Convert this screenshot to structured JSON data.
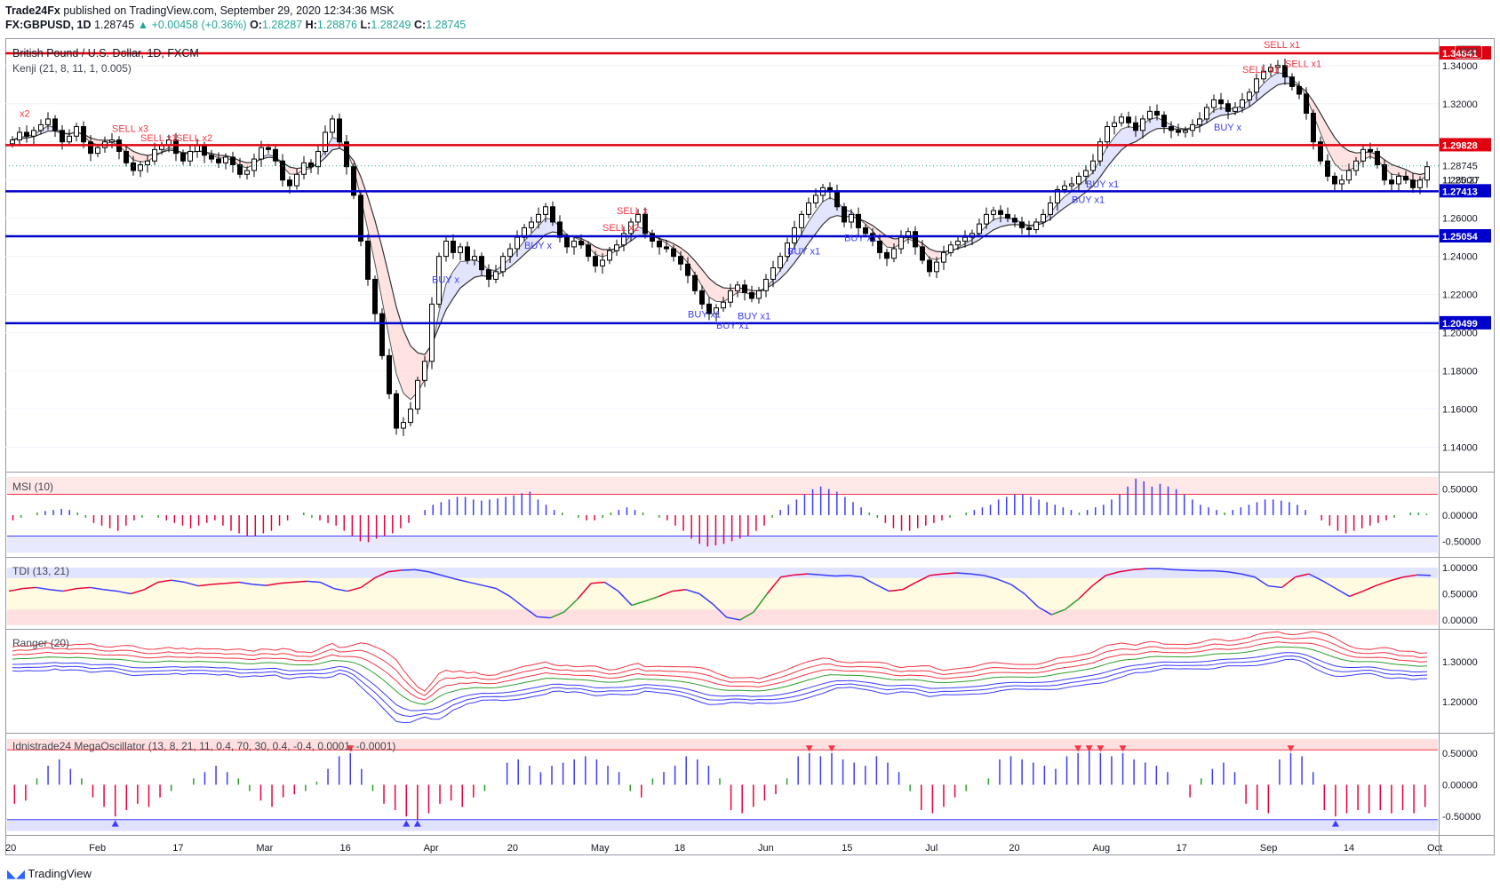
{
  "header": {
    "publisher": "Trade24Fx",
    "published_text": "published on TradingView.com, September 29, 2020 12:34:36 MSK",
    "symbol": "FX:GBPUSD, 1D",
    "last": "1.28745",
    "change": "+0.00458 (+0.36%)",
    "open_label": "O:",
    "open": "1.28287",
    "high_label": "H:",
    "high": "1.28876",
    "low_label": "L:",
    "low": "1.28249",
    "close_label": "C:",
    "close": "1.28745"
  },
  "currency_badge": "USD",
  "countdown": "11:25:27",
  "footer_brand": "TradingView",
  "colors": {
    "red_line": "#e0000f",
    "blue_line": "#0000cc",
    "bull": "#ffffff",
    "bear": "#000000",
    "indicator_blue": "#3b3bff",
    "indicator_red": "#e8003b",
    "indicator_green": "#2e9d2e"
  },
  "x_axis": [
    "20",
    "Feb",
    "17",
    "Mar",
    "16",
    "Apr",
    "20",
    "May",
    "18",
    "Jun",
    "15",
    "Jul",
    "20",
    "Aug",
    "17",
    "Sep",
    "14",
    "Oct"
  ],
  "chart_data": [
    {
      "type": "candlestick",
      "title": "British Pound / U.S. Dollar, 1D, FXCM",
      "indicator_label": "Kenji (21, 8, 11, 1, 0.005)",
      "y_ticks": [
        "1.34000",
        "1.32000",
        "1.30000",
        "1.28000",
        "1.26000",
        "1.24000",
        "1.22000",
        "1.20000",
        "1.18000",
        "1.16000",
        "1.14000"
      ],
      "ylim": [
        1.13,
        1.352
      ],
      "horizontal_levels": [
        {
          "value": "1.34641",
          "color": "red"
        },
        {
          "value": "1.29828",
          "color": "red"
        },
        {
          "value": "1.27413",
          "color": "blue"
        },
        {
          "value": "1.25054",
          "color": "blue"
        },
        {
          "value": "1.20499",
          "color": "blue"
        }
      ],
      "last_price": "1.28745",
      "close_path": [
        1.301,
        1.305,
        1.303,
        1.306,
        1.309,
        1.312,
        1.306,
        1.3,
        1.303,
        1.308,
        1.3,
        1.294,
        1.297,
        1.3,
        1.301,
        1.295,
        1.289,
        1.285,
        1.288,
        1.29,
        1.296,
        1.298,
        1.301,
        1.294,
        1.29,
        1.295,
        1.298,
        1.293,
        1.291,
        1.289,
        1.292,
        1.288,
        1.283,
        1.285,
        1.291,
        1.297,
        1.296,
        1.29,
        1.28,
        1.277,
        1.283,
        1.289,
        1.287,
        1.295,
        1.305,
        1.312,
        1.3,
        1.287,
        1.272,
        1.248,
        1.228,
        1.21,
        1.188,
        1.168,
        1.15,
        1.153,
        1.16,
        1.175,
        1.185,
        1.215,
        1.24,
        1.248,
        1.242,
        1.245,
        1.238,
        1.24,
        1.233,
        1.228,
        1.232,
        1.24,
        1.244,
        1.25,
        1.255,
        1.258,
        1.262,
        1.266,
        1.258,
        1.25,
        1.245,
        1.248,
        1.246,
        1.24,
        1.235,
        1.238,
        1.243,
        1.246,
        1.252,
        1.258,
        1.262,
        1.252,
        1.248,
        1.245,
        1.244,
        1.24,
        1.236,
        1.23,
        1.222,
        1.215,
        1.21,
        1.213,
        1.216,
        1.222,
        1.225,
        1.221,
        1.218,
        1.222,
        1.228,
        1.234,
        1.24,
        1.247,
        1.255,
        1.262,
        1.268,
        1.272,
        1.276,
        1.274,
        1.266,
        1.258,
        1.262,
        1.255,
        1.252,
        1.248,
        1.242,
        1.239,
        1.244,
        1.25,
        1.253,
        1.245,
        1.238,
        1.232,
        1.237,
        1.242,
        1.246,
        1.248,
        1.25,
        1.252,
        1.257,
        1.262,
        1.264,
        1.262,
        1.26,
        1.258,
        1.255,
        1.254,
        1.258,
        1.262,
        1.268,
        1.275,
        1.277,
        1.278,
        1.282,
        1.285,
        1.29,
        1.3,
        1.308,
        1.31,
        1.313,
        1.31,
        1.306,
        1.312,
        1.316,
        1.314,
        1.308,
        1.306,
        1.305,
        1.306,
        1.309,
        1.312,
        1.318,
        1.322,
        1.32,
        1.316,
        1.318,
        1.322,
        1.326,
        1.333,
        1.337,
        1.339,
        1.34,
        1.334,
        1.329,
        1.325,
        1.315,
        1.3,
        1.29,
        1.282,
        1.278,
        1.28,
        1.285,
        1.29,
        1.296,
        1.295,
        1.288,
        1.28,
        1.278,
        1.282,
        1.28,
        1.276,
        1.28,
        1.287
      ],
      "signals": [
        {
          "text": "x2",
          "type": "sell"
        },
        {
          "text": "SELL x3",
          "type": "sell"
        },
        {
          "text": "SELL x1",
          "type": "sell"
        },
        {
          "text": "SELL x2",
          "type": "sell"
        },
        {
          "text": "BUY x",
          "type": "buy"
        },
        {
          "text": "BUY x",
          "type": "buy"
        },
        {
          "text": "SELL x2",
          "type": "sell"
        },
        {
          "text": "SELL x",
          "type": "sell"
        },
        {
          "text": "BUY x1",
          "type": "buy"
        },
        {
          "text": "BUY x1",
          "type": "buy"
        },
        {
          "text": "BUY x1",
          "type": "buy"
        },
        {
          "text": "BUY x1",
          "type": "buy"
        },
        {
          "text": "BUY x1",
          "type": "buy"
        },
        {
          "text": "BUY x1",
          "type": "buy"
        },
        {
          "text": "BUY x1",
          "type": "buy"
        },
        {
          "text": "BUY x",
          "type": "buy"
        },
        {
          "text": "SELL x1",
          "type": "sell"
        },
        {
          "text": "SELL x1",
          "type": "sell"
        },
        {
          "text": "SELL x1",
          "type": "sell"
        }
      ]
    },
    {
      "type": "histogram",
      "title": "MSI (10)",
      "y_ticks": [
        "0.50000",
        "0.00000",
        "-0.50000"
      ],
      "ylim": [
        -0.75,
        0.75
      ],
      "band": [
        -0.4,
        0.4
      ],
      "values": [
        -0.1,
        -0.05,
        0.0,
        0.05,
        0.08,
        0.1,
        0.12,
        0.1,
        0.05,
        -0.05,
        -0.15,
        -0.2,
        -0.25,
        -0.3,
        -0.2,
        -0.1,
        -0.05,
        0.0,
        -0.05,
        -0.1,
        -0.15,
        -0.2,
        -0.25,
        -0.2,
        -0.15,
        -0.1,
        -0.2,
        -0.3,
        -0.35,
        -0.4,
        -0.4,
        -0.35,
        -0.3,
        -0.2,
        -0.1,
        0.0,
        0.05,
        -0.05,
        -0.1,
        -0.15,
        -0.2,
        -0.3,
        -0.4,
        -0.5,
        -0.52,
        -0.45,
        -0.4,
        -0.35,
        -0.25,
        -0.15,
        0.0,
        0.1,
        0.2,
        0.25,
        0.3,
        0.35,
        0.35,
        0.3,
        0.28,
        0.3,
        0.32,
        0.35,
        0.38,
        0.42,
        0.45,
        0.3,
        0.2,
        0.1,
        0.05,
        0.0,
        -0.05,
        -0.1,
        -0.1,
        -0.05,
        0.05,
        0.1,
        0.15,
        0.1,
        0.05,
        0.0,
        -0.05,
        -0.1,
        -0.2,
        -0.3,
        -0.45,
        -0.55,
        -0.6,
        -0.58,
        -0.55,
        -0.5,
        -0.45,
        -0.4,
        -0.3,
        -0.2,
        -0.05,
        0.1,
        0.2,
        0.3,
        0.4,
        0.5,
        0.55,
        0.5,
        0.45,
        0.35,
        0.25,
        0.15,
        0.05,
        -0.05,
        -0.15,
        -0.25,
        -0.3,
        -0.3,
        -0.25,
        -0.2,
        -0.15,
        -0.1,
        -0.05,
        0.0,
        0.05,
        0.1,
        0.15,
        0.2,
        0.3,
        0.35,
        0.4,
        0.4,
        0.35,
        0.3,
        0.25,
        0.2,
        0.15,
        0.1,
        0.05,
        0.1,
        0.15,
        0.2,
        0.3,
        0.4,
        0.55,
        0.7,
        0.65,
        0.55,
        0.6,
        0.55,
        0.5,
        0.4,
        0.3,
        0.2,
        0.15,
        0.1,
        0.05,
        0.1,
        0.15,
        0.2,
        0.25,
        0.3,
        0.3,
        0.28,
        0.25,
        0.2,
        0.1,
        0.0,
        -0.1,
        -0.2,
        -0.3,
        -0.35,
        -0.3,
        -0.25,
        -0.2,
        -0.15,
        -0.1,
        -0.05,
        0.0,
        0.05,
        0.05,
        0.03
      ]
    },
    {
      "type": "line",
      "title": "TDI (13, 21)",
      "y_ticks": [
        "1.00000",
        "0.50000",
        "0.00000"
      ],
      "ylim": [
        -0.12,
        1.12
      ],
      "band_upper": [
        0.8,
        1.0
      ],
      "band_mid": [
        0.2,
        0.8
      ],
      "band_lower": [
        -0.1,
        0.2
      ],
      "values": [
        0.55,
        0.6,
        0.62,
        0.58,
        0.55,
        0.6,
        0.62,
        0.58,
        0.55,
        0.5,
        0.58,
        0.72,
        0.76,
        0.72,
        0.65,
        0.68,
        0.7,
        0.72,
        0.68,
        0.66,
        0.7,
        0.72,
        0.74,
        0.72,
        0.6,
        0.55,
        0.62,
        0.8,
        0.92,
        0.95,
        0.96,
        0.92,
        0.85,
        0.78,
        0.72,
        0.66,
        0.6,
        0.45,
        0.25,
        0.06,
        0.04,
        0.15,
        0.4,
        0.7,
        0.72,
        0.55,
        0.28,
        0.36,
        0.45,
        0.55,
        0.58,
        0.5,
        0.3,
        0.05,
        0.0,
        0.15,
        0.5,
        0.82,
        0.86,
        0.88,
        0.86,
        0.84,
        0.85,
        0.82,
        0.68,
        0.55,
        0.58,
        0.72,
        0.85,
        0.88,
        0.9,
        0.88,
        0.85,
        0.78,
        0.68,
        0.5,
        0.25,
        0.1,
        0.2,
        0.4,
        0.65,
        0.85,
        0.92,
        0.96,
        0.98,
        0.98,
        0.96,
        0.95,
        0.94,
        0.94,
        0.92,
        0.88,
        0.82,
        0.65,
        0.62,
        0.82,
        0.88,
        0.75,
        0.6,
        0.45,
        0.55,
        0.66,
        0.75,
        0.82,
        0.86,
        0.85
      ]
    },
    {
      "type": "line",
      "title": "Ranger (20)",
      "y_ticks": [
        "1.30000",
        "1.20000"
      ],
      "ylim": [
        1.13,
        1.37
      ]
    },
    {
      "type": "histogram",
      "title": "Idnistrade24 MegaOscillator (13, 8, 21, 11, 0.4, 70, 30, 0.4, -0.4, 0.0001, -0.0001)",
      "y_ticks": [
        "0.50000",
        "0.00000",
        "-0.50000"
      ],
      "ylim": [
        -0.75,
        0.75
      ],
      "band": [
        -0.55,
        0.55
      ],
      "values": [
        -0.3,
        -0.25,
        0.1,
        0.3,
        0.4,
        0.25,
        0.1,
        -0.2,
        -0.35,
        -0.5,
        -0.4,
        -0.3,
        -0.35,
        -0.2,
        -0.1,
        0.0,
        0.1,
        0.2,
        0.3,
        0.2,
        0.1,
        -0.1,
        -0.25,
        -0.35,
        -0.2,
        -0.15,
        -0.1,
        0.05,
        0.25,
        0.45,
        0.5,
        0.25,
        -0.1,
        -0.3,
        -0.4,
        -0.5,
        -0.55,
        -0.45,
        -0.3,
        -0.25,
        -0.35,
        -0.2,
        -0.1,
        0.0,
        0.35,
        0.4,
        0.3,
        0.2,
        0.3,
        0.35,
        0.4,
        0.45,
        0.4,
        0.3,
        0.2,
        -0.1,
        -0.2,
        0.1,
        0.2,
        0.3,
        0.45,
        0.4,
        0.3,
        0.1,
        -0.4,
        -0.45,
        -0.35,
        -0.25,
        -0.15,
        0.1,
        0.45,
        0.5,
        0.45,
        0.5,
        0.4,
        0.35,
        0.3,
        0.45,
        0.35,
        0.2,
        -0.1,
        -0.4,
        -0.45,
        -0.35,
        -0.2,
        -0.1,
        0.0,
        0.1,
        0.4,
        0.45,
        0.4,
        0.35,
        0.3,
        0.25,
        0.45,
        0.5,
        0.55,
        0.5,
        0.45,
        0.5,
        0.4,
        0.35,
        0.3,
        0.2,
        0.0,
        -0.2,
        0.1,
        0.25,
        0.35,
        0.2,
        -0.3,
        -0.4,
        -0.45,
        0.4,
        0.5,
        0.45,
        0.2,
        -0.4,
        -0.5,
        -0.45,
        -0.4,
        -0.45,
        -0.4,
        -0.45,
        -0.4,
        -0.45,
        -0.35
      ]
    }
  ]
}
